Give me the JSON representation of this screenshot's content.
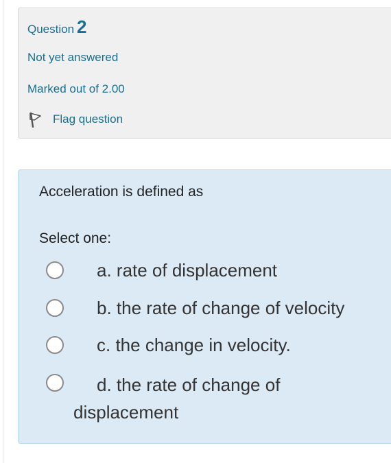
{
  "question": {
    "label": "Question",
    "number": "2",
    "status": "Not yet answered",
    "marks": "Marked out of 2.00",
    "flag_label": "Flag question"
  },
  "content": {
    "question_text": "Acceleration is defined as",
    "prompt": "Select one:",
    "options": [
      {
        "label": "a. rate of displacement"
      },
      {
        "label": "b. the rate of change of velocity"
      },
      {
        "label": "c.  the change in velocity."
      },
      {
        "label": "d. the rate of change of displacement"
      }
    ]
  },
  "colors": {
    "info_text": "#1a6e8e",
    "info_background": "#f0f0f0",
    "content_background": "#dbeaf5",
    "content_border": "#b8dced"
  },
  "icons": {
    "flag": "flag-icon",
    "radio": "radio-button"
  }
}
